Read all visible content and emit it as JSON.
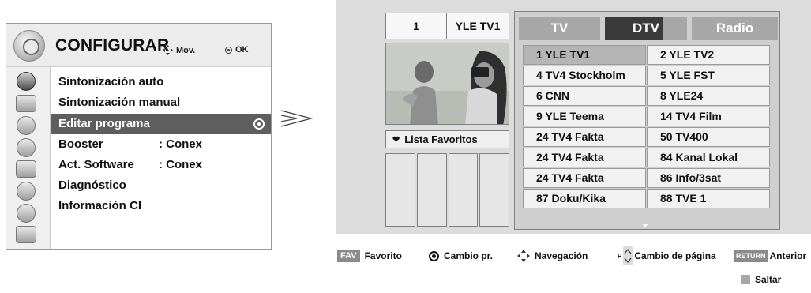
{
  "menu": {
    "title": "CONFIGURAR",
    "move_hint": "Mov.",
    "ok_hint": "OK",
    "items": [
      {
        "label": "Sintonización auto",
        "value": ""
      },
      {
        "label": "Sintonización manual",
        "value": ""
      },
      {
        "label": "Editar programa",
        "value": "",
        "selected": true
      },
      {
        "label": "Booster",
        "value": ": Conex"
      },
      {
        "label": "Act. Software",
        "value": ": Conex"
      },
      {
        "label": "Diagnóstico",
        "value": ""
      },
      {
        "label": "Información CI",
        "value": ""
      }
    ]
  },
  "current_program": {
    "number": "1",
    "name": "YLE TV1"
  },
  "favorites": {
    "label": "Lista Favoritos"
  },
  "tabs": {
    "tv": "TV",
    "dtv": "DTV",
    "radio": "Radio",
    "active": "dtv"
  },
  "channels": [
    [
      "1 YLE TV1",
      "2 YLE TV2"
    ],
    [
      "4 TV4 Stockholm",
      "5 YLE FST"
    ],
    [
      "6 CNN",
      "8 YLE24"
    ],
    [
      "9 YLE Teema",
      "14 TV4 Film"
    ],
    [
      "24 TV4 Fakta",
      "50 TV400"
    ],
    [
      "24 TV4 Fakta",
      "84 Kanal Lokal"
    ],
    [
      "24 TV4 Fakta",
      "86 Info/3sat"
    ],
    [
      "87 Doku/Kika",
      "88 TVE 1"
    ]
  ],
  "legend": {
    "fav_key": "FAV",
    "fav_label": "Favorito",
    "change_label": "Cambio pr.",
    "nav_label": "Navegación",
    "p_key": "P",
    "page_label": "Cambio de página",
    "return_key": "RETURN",
    "return_label": "Anterior",
    "skip_label": "Saltar"
  }
}
